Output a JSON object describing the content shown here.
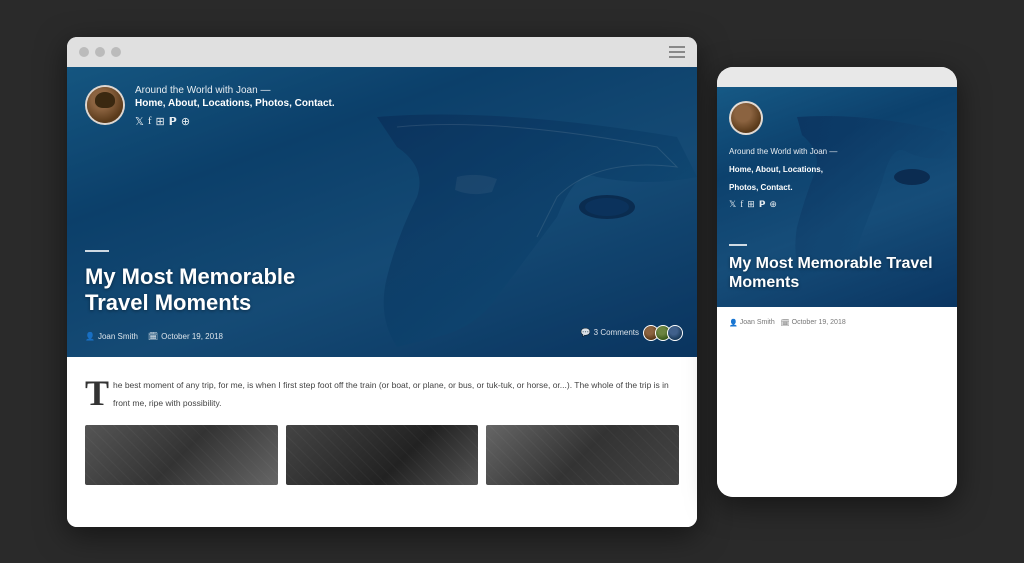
{
  "desktop": {
    "site_name": "Around the World with Joan —",
    "nav_menu": "Home, About, Locations, Photos, Contact.",
    "hero_title": "My Most Memorable\nTravel Moments",
    "author": "Joan Smith",
    "date": "October 19, 2018",
    "comments": "3 Comments",
    "article_text": "he best moment of any trip, for me, is when I first step foot off the train (or boat, or plane, or bus, or tuk-tuk, or horse, or...). The whole of the trip is in front me, ripe with possibility.",
    "social_icons": [
      "𝕏",
      "f",
      "📷",
      "𝗣",
      "⊕"
    ]
  },
  "mobile": {
    "site_name": "Around the World with Joan —",
    "nav_menu_line1": "Home, About, Locations,",
    "nav_menu_line2": "Photos, Contact.",
    "hero_title": "My Most Memorable\nTravel Moments",
    "author": "Joan Smith",
    "date": "October 19, 2018"
  },
  "icons": {
    "hamburger": "≡",
    "author_icon": "👤",
    "calendar_icon": "📅",
    "comment_icon": "💬",
    "twitter": "𝕋",
    "facebook": "f",
    "instagram": "ℹ",
    "pinterest": "P",
    "wordpress": "W"
  }
}
